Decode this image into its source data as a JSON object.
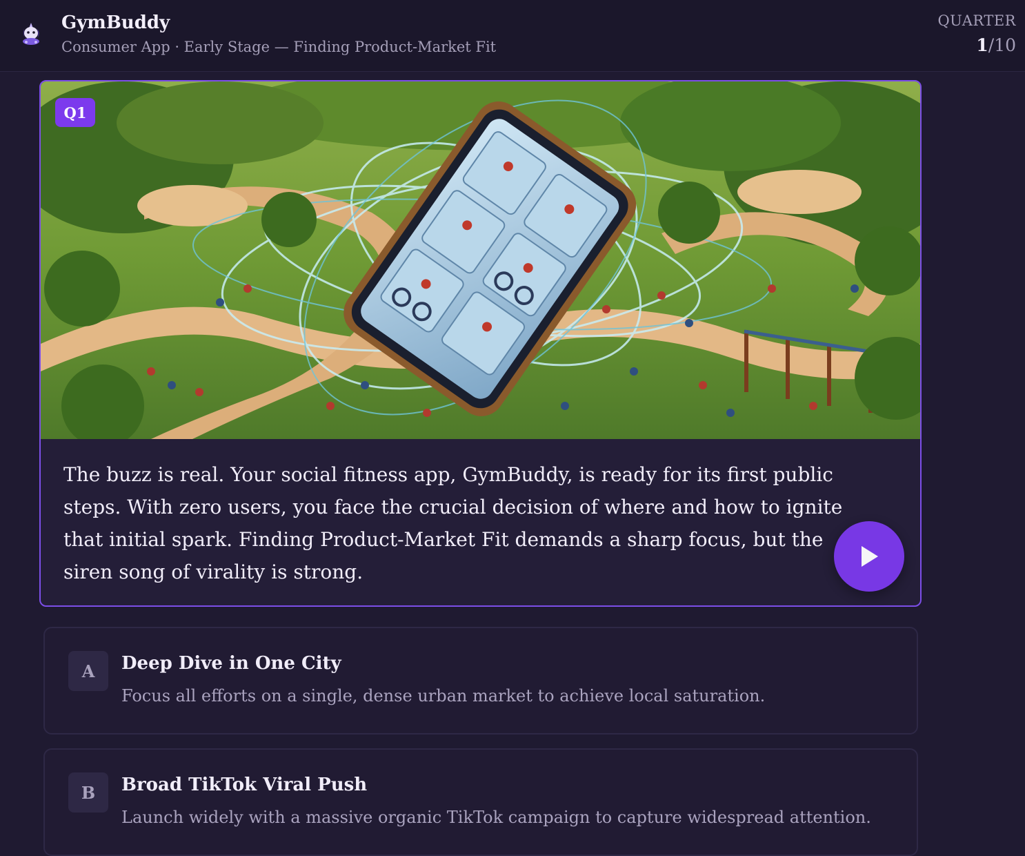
{
  "header": {
    "logo_icon": "unicorn-mascot-icon",
    "title": "GymBuddy",
    "subtitle": "Consumer App · Early Stage — Finding Product-Market Fit",
    "quarter_label": "QUARTER",
    "quarter_current": "1",
    "quarter_total": "/10"
  },
  "scene": {
    "badge": "Q1",
    "illustration": "painted park scene with a giant smartphone showing runners and cyclists, surrounded by people exercising",
    "text": "The buzz is real. Your social fitness app, GymBuddy, is ready for its first public steps. With zero users, you face the crucial decision of where and how to ignite that initial spark. Finding Product-Market Fit demands a sharp focus, but the siren song of virality is strong.",
    "play_icon": "play-icon"
  },
  "options": [
    {
      "letter": "A",
      "title": "Deep Dive in One City",
      "description": "Focus all efforts on a single, dense urban market to achieve local saturation."
    },
    {
      "letter": "B",
      "title": "Broad TikTok Viral Push",
      "description": "Launch widely with a massive organic TikTok campaign to capture widespread attention."
    }
  ],
  "colors": {
    "accent": "#7c3aed",
    "background": "#1f1a31",
    "header_bg": "#1b172b",
    "card_border": "#7c4ee8"
  }
}
